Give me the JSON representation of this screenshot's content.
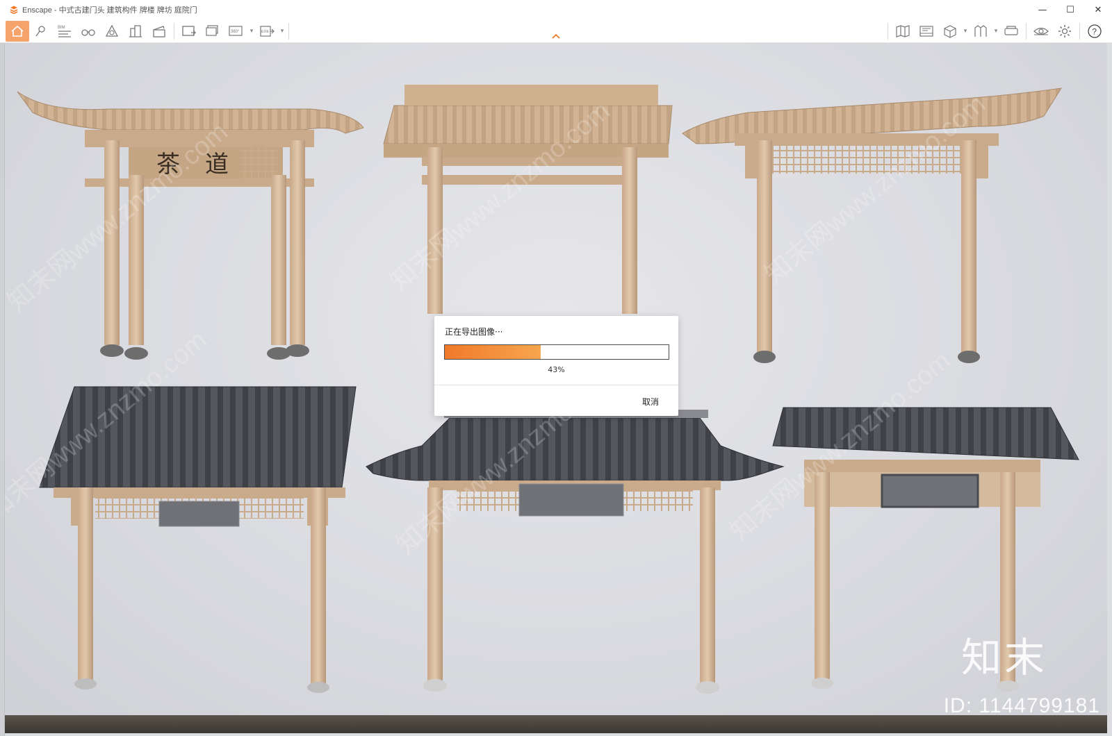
{
  "window": {
    "title": "Enscape - 中式古建门头 建筑构件 牌楼 牌坊 庭院门",
    "minimize": "—",
    "maximize": "☐",
    "close": "✕",
    "accent": "#f07a2a"
  },
  "toolbar": {
    "left_buttons": [
      {
        "name": "home-icon"
      },
      {
        "name": "pin-icon"
      },
      {
        "name": "bim-icon",
        "label": "BIM"
      },
      {
        "name": "binoculars-icon"
      },
      {
        "name": "shape-icon"
      },
      {
        "name": "buildings-icon"
      },
      {
        "name": "clapper-icon"
      },
      {
        "name": "screenshot-icon"
      },
      {
        "name": "batch-render-icon"
      },
      {
        "name": "panorama-icon",
        "label": "360°"
      },
      {
        "name": "export-exe-icon",
        "label": "EXE"
      }
    ],
    "right_buttons": [
      {
        "name": "map-icon"
      },
      {
        "name": "video-editor-icon"
      },
      {
        "name": "cube-icon"
      },
      {
        "name": "asset-library-icon"
      },
      {
        "name": "vr-headset-icon"
      },
      {
        "name": "visual-settings-eye-icon"
      },
      {
        "name": "settings-gear-icon"
      },
      {
        "name": "help-icon",
        "label": "?"
      }
    ]
  },
  "watermarks": {
    "text": "知末网www.znzmo.com",
    "logo": "知末",
    "id": "ID: 1144799181"
  },
  "dialog": {
    "title": "正在导出图像···",
    "progress": 0.43,
    "progress_label": "43%",
    "cancel_label": "取消"
  }
}
